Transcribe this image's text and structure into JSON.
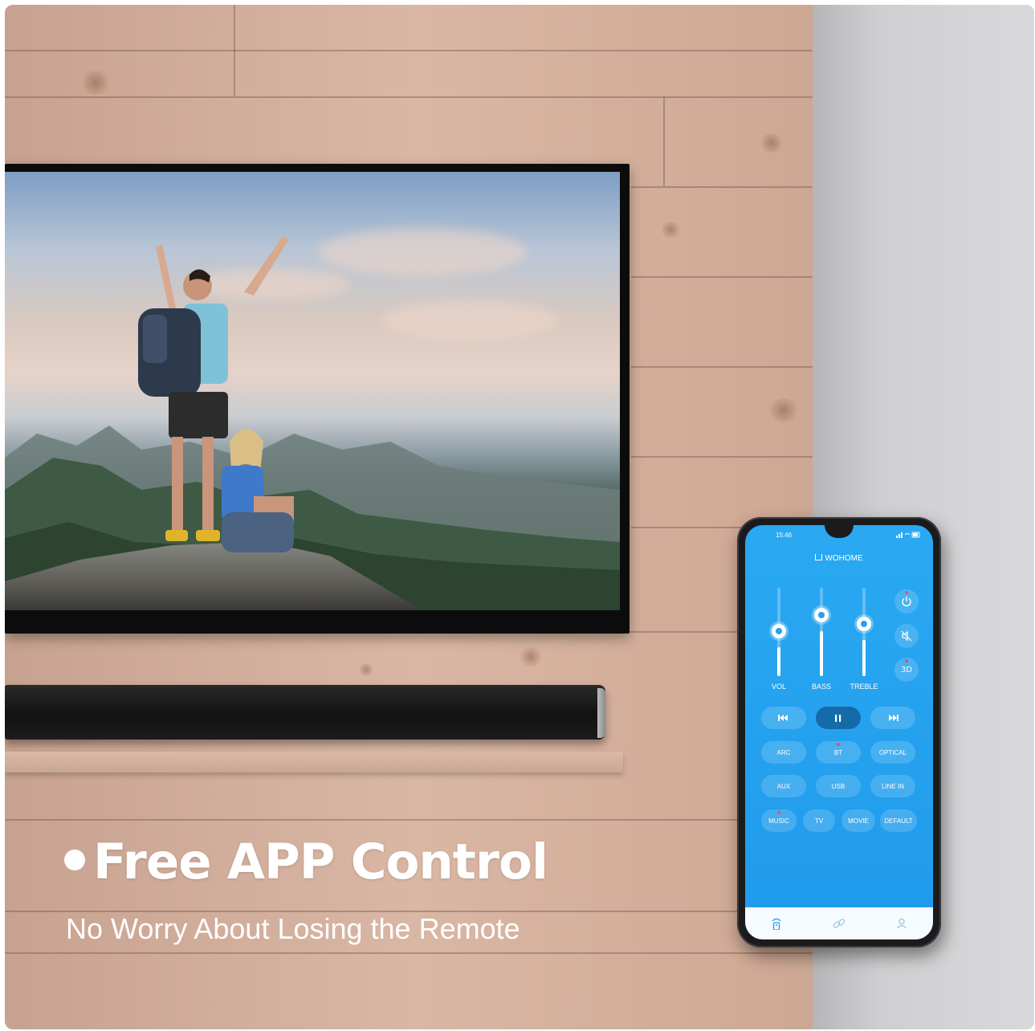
{
  "headline": {
    "bullet": "•",
    "title": "Free APP Control",
    "subtitle": "No Worry About Losing the Remote"
  },
  "phone": {
    "status_time": "15:46",
    "app_name": "WOHOME",
    "sliders": [
      {
        "label": "VOL",
        "level": 0.4
      },
      {
        "label": "BASS",
        "level": 0.62
      },
      {
        "label": "TREBLE",
        "level": 0.5
      }
    ],
    "side_buttons": [
      {
        "name": "power-icon",
        "label": "",
        "indicator": true
      },
      {
        "name": "mute-icon",
        "label": "",
        "indicator": false
      },
      {
        "name": "3d-button",
        "label": "3D",
        "indicator": true
      }
    ],
    "transport": {
      "prev": "⏮",
      "play_pause": "II",
      "next": "⏭"
    },
    "inputs": [
      {
        "label": "ARC",
        "indicator": false
      },
      {
        "label": "BT",
        "indicator": true
      },
      {
        "label": "OPTICAL",
        "indicator": false
      },
      {
        "label": "AUX",
        "indicator": false
      },
      {
        "label": "USB",
        "indicator": false
      },
      {
        "label": "LINE IN",
        "indicator": false
      }
    ],
    "eq_modes": [
      {
        "label": "MUSIC",
        "indicator": true
      },
      {
        "label": "TV",
        "indicator": false
      },
      {
        "label": "MOVIE",
        "indicator": false
      },
      {
        "label": "DEFAULT",
        "indicator": false
      }
    ],
    "nav": [
      "remote-icon",
      "link-icon",
      "profile-icon"
    ]
  },
  "colors": {
    "screen_blue": "#2aa9f2",
    "indicator_red": "#ff4a4a",
    "nav_active": "#1aa0ee"
  }
}
